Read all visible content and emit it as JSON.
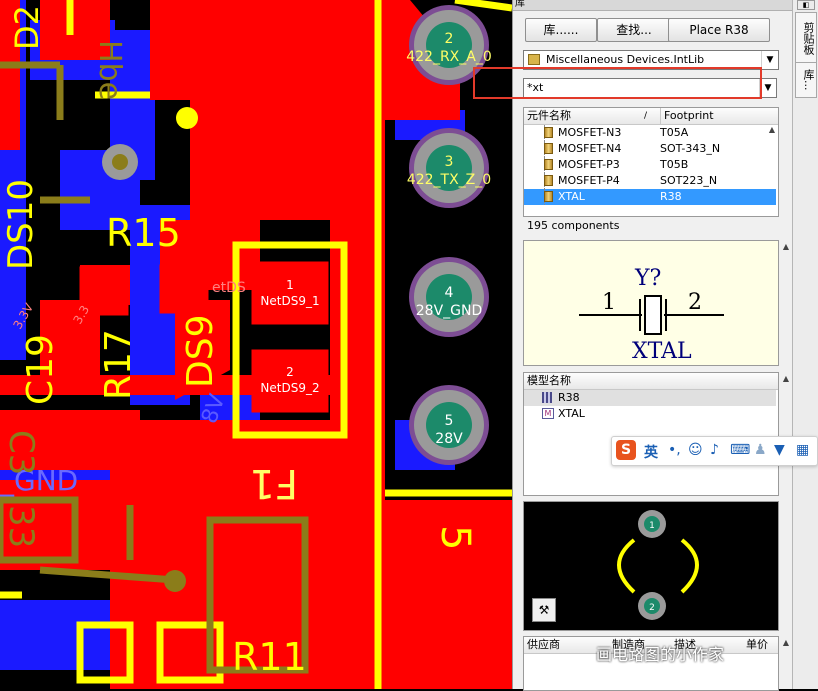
{
  "pcb": {
    "pad_labels": [
      {
        "num": "2",
        "net": "422_RX_A_0"
      },
      {
        "num": "3",
        "net": "422_TX_Z_0"
      },
      {
        "num": "4",
        "net": "28V_GND"
      },
      {
        "num": "5",
        "net": "28V"
      }
    ],
    "smd_pads": [
      {
        "num": "1",
        "net": "NetDS9_1"
      },
      {
        "num": "2",
        "net": "NetDS9_2"
      }
    ],
    "designators": {
      "r15": "R15",
      "ds9": "DS9",
      "r17": "R17",
      "c19": "C19",
      "r11": "R11",
      "f1": "F1",
      "ds10": "DS10",
      "d2": "D2",
      "gnd": "_GND",
      "v33a": "3.3V",
      "v33b": "3.3",
      "netds": "etDS",
      "pin5": "5",
      "c3": "C3",
      "n33": "33",
      "hbe": "Hbe",
      "v8": "8V"
    },
    "colors": {
      "board": "#000000",
      "top_copper": "#ff0000",
      "bottom_copper": "#1a1aff",
      "silk": "#ffff00",
      "overlay": "#8b7d1a",
      "pad": "#9a9a9a",
      "pad_hole": "#1c8a6a"
    }
  },
  "panel": {
    "title": "库",
    "buttons": {
      "library": "库......",
      "search": "查找...",
      "place": "Place R38"
    },
    "library_select": "Miscellaneous Devices.IntLib",
    "filter_value": "*xt",
    "table": {
      "col_name": "元件名称",
      "col_footprint": "Footprint",
      "rows": [
        {
          "name": "MOSFET-N3",
          "footprint": "T05A",
          "selected": false
        },
        {
          "name": "MOSFET-N4",
          "footprint": "SOT-343_N",
          "selected": false
        },
        {
          "name": "MOSFET-P3",
          "footprint": "T05B",
          "selected": false
        },
        {
          "name": "MOSFET-P4",
          "footprint": "SOT223_N",
          "selected": false
        },
        {
          "name": "XTAL",
          "footprint": "R38",
          "selected": true
        }
      ]
    },
    "component_count": "195 components",
    "symbol": {
      "designator": "Y?",
      "pin1": "1",
      "pin2": "2",
      "name": "XTAL"
    },
    "models": {
      "header": "模型名称",
      "items": [
        {
          "name": "R38",
          "icon": "footprint-icon"
        },
        {
          "name": "XTAL",
          "icon": "sim-model-icon"
        }
      ]
    },
    "footprint_preview": {
      "pad1": "1",
      "pad2": "2"
    },
    "supplier_header": {
      "c1": "供应商",
      "c2": "制造商",
      "c3": "描述",
      "c4": "单价"
    }
  },
  "sidebar": {
    "tab1": "剪贴板",
    "tab2": "库..."
  },
  "ime": {
    "label": "英"
  },
  "watermark": "画电路图的小作家"
}
